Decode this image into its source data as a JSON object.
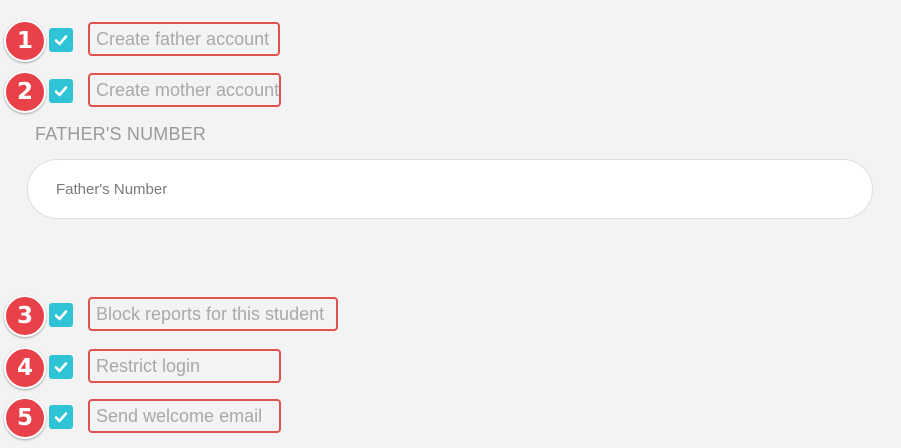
{
  "options": [
    {
      "number": "1",
      "label": "Create father account",
      "checked": true
    },
    {
      "number": "2",
      "label": "Create mother account",
      "checked": true
    },
    {
      "number": "3",
      "label": "Block reports for this student",
      "checked": true
    },
    {
      "number": "4",
      "label": "Restrict login",
      "checked": true
    },
    {
      "number": "5",
      "label": "Send welcome email",
      "checked": true
    }
  ],
  "fathers_number": {
    "section_label": "FATHER'S NUMBER",
    "placeholder": "Father's Number",
    "value": ""
  },
  "colors": {
    "checkbox": "#2ec4d6",
    "badge": "#e8414a",
    "highlight_border": "#e0524f",
    "background": "#f3f3f3"
  },
  "icons": {
    "checkbox_mark": "checkmark-icon"
  }
}
